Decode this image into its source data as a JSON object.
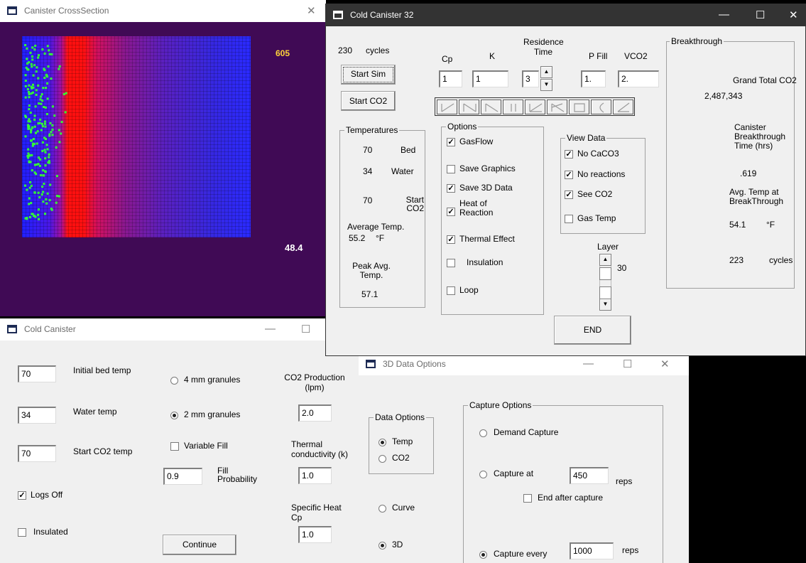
{
  "crosssection": {
    "title": "Canister CrossSection",
    "close_glyph": "✕",
    "reading_top": "605",
    "reading_bottom": "48.4",
    "colors": {
      "bg": "#400a55",
      "cold": "#2028ff",
      "hot": "#ff1010",
      "dot": "#33ff33",
      "reading": "#ffd33a"
    }
  },
  "main": {
    "title": "Cold Canister 32",
    "window_controls": [
      "—",
      "☐",
      "✕"
    ],
    "cycles_count": "230",
    "cycles_label": "cycles",
    "start_sim_label": "Start Sim",
    "start_co2_label": "Start CO2",
    "params": {
      "cp_label": "Cp",
      "k_label": "K",
      "residence_label": "Residence Time",
      "pfill_label": "P Fill",
      "vco2_label": "VCO2",
      "cp_value": "1",
      "k_value": "1",
      "residence_value": "3",
      "pfill_value": "1.",
      "vco2_value": "2."
    },
    "shape_icons": [
      "ramp-up-icon",
      "notch-icon",
      "peak-icon",
      "parallel-icon",
      "fan-icon",
      "step-icon",
      "square-icon",
      "arc-icon",
      "wedge-icon"
    ],
    "temperatures": {
      "caption": "Temperatures",
      "bed_value": "70",
      "bed_label": "Bed",
      "water_value": "34",
      "water_label": "Water",
      "start_value": "70",
      "start_label": "Start CO2",
      "avg_label": "Average Temp.",
      "avg_value": "55.2",
      "avg_unit": "°F",
      "peak_label": "Peak Avg. Temp.",
      "peak_value": "57.1"
    },
    "options": {
      "caption": "Options",
      "gasflow": "GasFlow",
      "save_graphics": "Save Graphics",
      "save_3d": "Save 3D Data",
      "heat_reaction": "Heat of Reaction",
      "thermal_effect": "Thermal Effect",
      "insulation": "Insulation",
      "loop": "Loop"
    },
    "view_data": {
      "caption": "View Data",
      "no_caco3": "No CaCO3",
      "no_reactions": "No reactions",
      "see_co2": "See CO2",
      "gas_temp": "Gas Temp"
    },
    "layer_label": "Layer",
    "layer_value": "30",
    "end_label": "END",
    "breakthrough": {
      "caption": "Breakthrough",
      "grand_total_label": "Grand Total CO2",
      "grand_total_value": "2,487,343",
      "bt_time_label": "Canister Breakthrough Time (hrs)",
      "bt_time_value": ".619",
      "avg_temp_label": "Avg. Temp at BreakThrough",
      "avg_temp_value": "54.1",
      "avg_temp_unit": "°F",
      "cycles_value": "223",
      "cycles_label": "cycles"
    }
  },
  "cold": {
    "title": "Cold Canister",
    "controls": [
      "—",
      "☐"
    ],
    "initial_bed_value": "70",
    "initial_bed_label": "Initial bed temp",
    "water_value": "34",
    "water_label": "Water temp",
    "start_co2_value": "70",
    "start_co2_label": "Start CO2 temp",
    "logs_off": "Logs Off",
    "insulated": "Insulated",
    "granules_4": "4 mm granules",
    "granules_2": "2 mm granules",
    "variable_fill": "Variable Fill",
    "fill_value": "0.9",
    "fill_label": "Fill Probability",
    "continue_label": "Continue",
    "co2_prod_label": "CO2 Production (lpm)",
    "co2_prod_value": "2.0",
    "thermal_label": "Thermal conductivity (k)",
    "thermal_value": "1.0",
    "specific_heat_label": "Specific Heat Cp",
    "specific_heat_value": "1.0"
  },
  "data3d": {
    "title": "3D Data Options",
    "controls": [
      "—",
      "☐",
      "✕"
    ],
    "data_options_caption": "Data Options",
    "temp": "Temp",
    "co2": "CO2",
    "curve": "Curve",
    "threed": "3D",
    "capture_caption": "Capture Options",
    "demand_capture": "Demand Capture",
    "capture_at": "Capture at",
    "capture_at_value": "450",
    "reps": "reps",
    "end_after_capture": "End after capture",
    "capture_every": "Capture every",
    "capture_every_value": "1000"
  }
}
